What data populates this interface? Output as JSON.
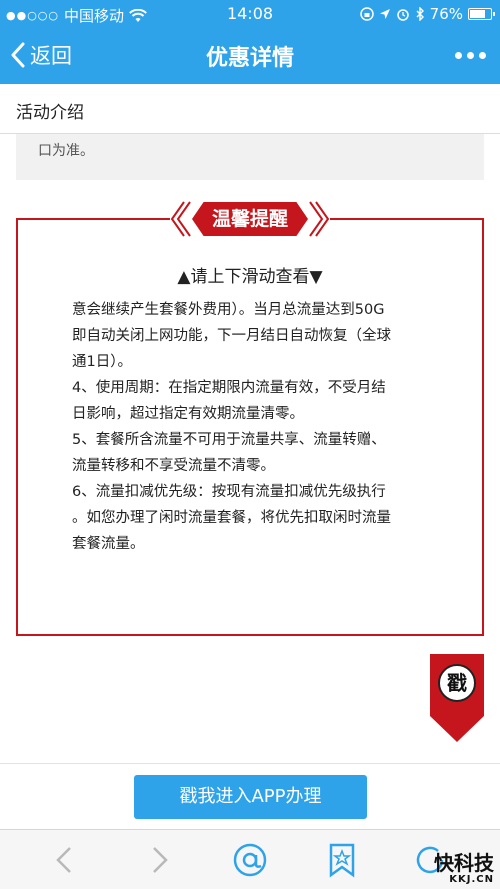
{
  "status_bar": {
    "signal_dots": "●●○○○",
    "carrier": "中国移动",
    "time": "14:08",
    "battery": "76%",
    "battery_level": 0.76
  },
  "nav": {
    "back_label": "返回",
    "title": "优惠详情"
  },
  "section": {
    "title": "活动介绍",
    "truncated_text": "口为准。"
  },
  "reminder": {
    "banner": "温馨提醒",
    "scroll_hint": "▲请上下滑动查看▼",
    "lines": [
      "意会继续产生套餐外费用）。当月总流量达到50G",
      "即自动关闭上网功能，下一月结日自动恢复（全球",
      "通1日）。",
      "4、使用周期：在指定期限内流量有效，不受月结",
      "日影响，超过指定有效期流量清零。",
      "5、套餐所含流量不可用于流量共享、流量转赠、",
      "流量转移和不享受流量不清零。",
      " 6、流量扣减优先级：按现有流量扣减优先级执行",
      "。如您办理了闲时流量套餐，将优先扣取闲时流量",
      "套餐流量。"
    ]
  },
  "stamp": {
    "label": "戳"
  },
  "action": {
    "button_label": "戳我进入APP办理"
  },
  "watermark": {
    "main": "快科技",
    "sub": "KKJ.CN"
  },
  "colors": {
    "brand_blue": "#2fa3ea",
    "accent_red": "#c4161c"
  }
}
